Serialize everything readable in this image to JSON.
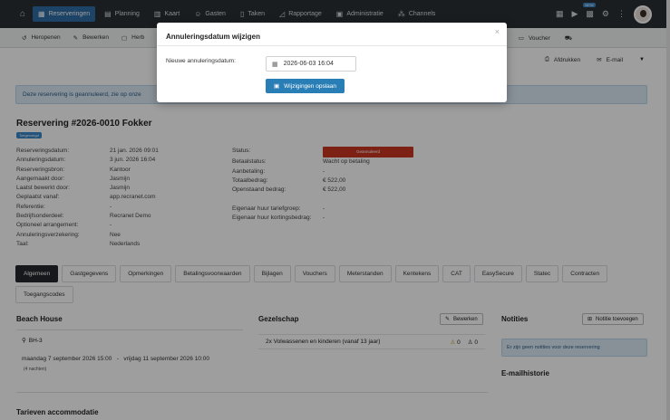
{
  "nav": {
    "items": [
      {
        "label": "Reserveringen",
        "icon": "calendar-grid-icon",
        "active": true
      },
      {
        "label": "Planning",
        "icon": "table-icon"
      },
      {
        "label": "Kaart",
        "icon": "map-icon"
      },
      {
        "label": "Gasten",
        "icon": "users-icon"
      },
      {
        "label": "Taken",
        "icon": "clipboard-icon"
      },
      {
        "label": "Rapportage",
        "icon": "chart-icon"
      },
      {
        "label": "Administratie",
        "icon": "ledger-icon"
      },
      {
        "label": "Channels",
        "icon": "sitemap-icon"
      }
    ],
    "new_badge": "NEW"
  },
  "toolbar": {
    "items": [
      {
        "label": "Heropenen",
        "icon": "reopen-icon"
      },
      {
        "label": "Bewerken",
        "icon": "pencil-icon"
      },
      {
        "label": "Herb",
        "icon": "doc-icon"
      }
    ],
    "right_items": [
      {
        "label": "Voucher",
        "icon": "ticket-icon"
      },
      {
        "label": "",
        "icon": "car-icon"
      }
    ]
  },
  "toolbar2": {
    "print_label": "Afdrukken",
    "email_label": "E-mail"
  },
  "alert": {
    "text": "Deze reservering is geannuleerd, zie op onze"
  },
  "reservation": {
    "title": "Reservering #2026-0010 Fokker",
    "tag": "Toegevoegd",
    "left": [
      {
        "k": "Reserveringsdatum:",
        "v": "21 jan. 2026 09:01"
      },
      {
        "k": "Annuleringsdatum:",
        "v": "3 jun. 2026 16:04"
      },
      {
        "k": "Reserveringsbron:",
        "v": "Kantoor"
      },
      {
        "k": "Aangemaakt door:",
        "v": "Jasmijn"
      },
      {
        "k": "Laatst bewerkt door:",
        "v": "Jasmijn"
      },
      {
        "k": "Geplaatst vanaf:",
        "v": "app.recranet.com"
      },
      {
        "k": "Referentie:",
        "v": "-"
      },
      {
        "k": "Bedrijfsonderdeel:",
        "v": "Recranet Demo"
      },
      {
        "k": "Optioneel arrangement:",
        "v": "-"
      },
      {
        "k": "Annuleringsverzekering:",
        "v": "Nee"
      },
      {
        "k": "Taal:",
        "v": "Nederlands"
      }
    ],
    "right": [
      {
        "k": "Status:",
        "v": "Geannuleerd",
        "type": "status"
      },
      {
        "k": "Betaalstatus:",
        "v": "Wacht op betaling",
        "type": "orange"
      },
      {
        "k": "Aanbetaling:",
        "v": "-"
      },
      {
        "k": "Totaalbedrag:",
        "v": "€ 522,00"
      },
      {
        "k": "Openstaand bedrag:",
        "v": "€ 522,00"
      },
      {
        "k": "",
        "v": ""
      },
      {
        "k": "Eigenaar huur tariefgroep:",
        "v": "-"
      },
      {
        "k": "Eigenaar huur kortingsbedrag:",
        "v": "-"
      }
    ]
  },
  "tabs": [
    "Algemeen",
    "Gastgegevens",
    "Opmerkingen",
    "Betalingsvoorwaarden",
    "Bijlagen",
    "Vouchers",
    "Meterstanden",
    "Kentekens",
    "CAT",
    "EasySecure",
    "Statec",
    "Contracten",
    "Toegangscodes"
  ],
  "sections": {
    "beach_house": "Beach House",
    "location": "BH-3",
    "arrival": "maandag 7 september 2026 15:00",
    "sep": "-",
    "departure": "vrijdag 11 september 2026 10:00",
    "nights": "(4 nachten)",
    "gezelschap": "Gezelschap",
    "edit_label": "Bewerken",
    "guests": "2x Volwassenen en kinderen (vanaf 13 jaar)",
    "adults": "0",
    "children": "0",
    "notities": "Notities",
    "add_note": "Notitie toevoegen",
    "no_notes": "Er zijn geen notities voor deze reservering",
    "email_history": "E-mailhistorie",
    "tarieven": "Tarieven accommodatie"
  },
  "modal": {
    "title": "Annuleringsdatum wijzigen",
    "close": "×",
    "label": "Nieuwe annuleringsdatum:",
    "date_value": "2026-06-03 16:04",
    "save_label": "Wijzigingen opslaan"
  }
}
